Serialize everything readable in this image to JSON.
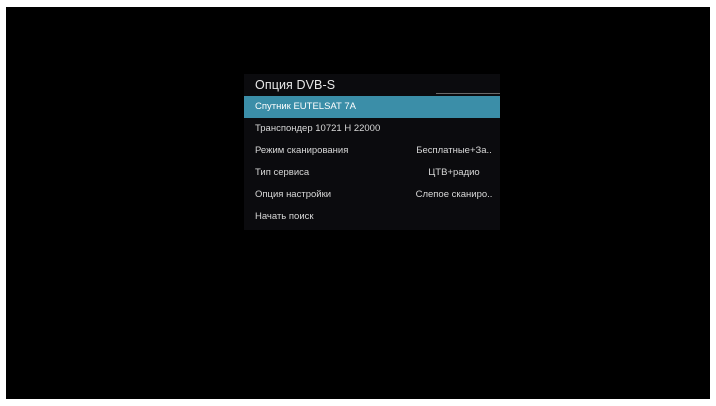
{
  "panel": {
    "title": "Опция DVB-S",
    "items": [
      {
        "label": "Спутник EUTELSAT 7A",
        "value": "",
        "selected": true
      },
      {
        "label": "Транспондер 10721 H 22000",
        "value": "",
        "selected": false
      },
      {
        "label": "Режим сканирования",
        "value": "Бесплатные+За..",
        "selected": false
      },
      {
        "label": "Тип сервиса",
        "value": "ЦТВ+радио",
        "selected": false
      },
      {
        "label": "Опция настройки",
        "value": "Слепое сканиро..",
        "selected": false
      },
      {
        "label": "Начать поиск",
        "value": "",
        "selected": false
      }
    ]
  },
  "colors": {
    "highlight": "#3b8ea8",
    "panel_bg": "#0b0b0e",
    "screen_bg": "#000000"
  }
}
